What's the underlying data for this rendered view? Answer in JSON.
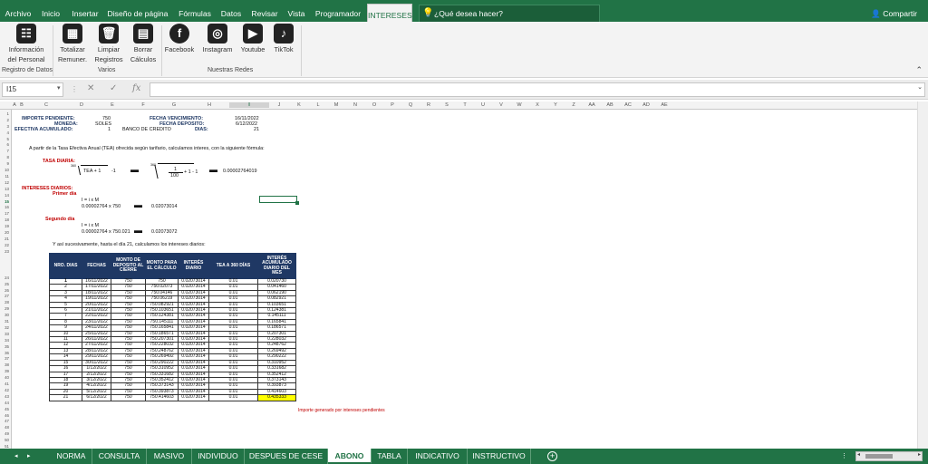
{
  "menu": {
    "tabs": [
      "Archivo",
      "Inicio",
      "Insertar",
      "Diseño de página",
      "Fórmulas",
      "Datos",
      "Revisar",
      "Vista",
      "Programador",
      "INTERESES"
    ],
    "search": "¿Qué desea hacer?",
    "share": "Compartir"
  },
  "ribbon": {
    "buttons": [
      "Información del Personal",
      "Totalizar Remuner.",
      "Limpiar Registros",
      "Borrar Cálculos",
      "Facebook",
      "Instagram",
      "Youtube",
      "TikTok"
    ],
    "groups": [
      "Registro de Datos",
      "Varios",
      "Nuestras Redes"
    ]
  },
  "formula_bar": {
    "cell_ref": "I15",
    "fx": "fx",
    "value": ""
  },
  "columns": [
    "A",
    "B",
    "C",
    "D",
    "E",
    "F",
    "G",
    "H",
    "I",
    "J",
    "K",
    "L",
    "M",
    "N",
    "O",
    "P",
    "Q",
    "R",
    "S",
    "T",
    "U",
    "V",
    "W",
    "X",
    "Y",
    "Z",
    "AA",
    "AB",
    "AC",
    "AD",
    "AE"
  ],
  "rows_count": 51,
  "sheet": {
    "importe_label": "IMPORTE PENDIENTE:",
    "importe_value": "750",
    "moneda_label": "MONEDA:",
    "moneda_value": "SOLES",
    "efectivo_label": "EFECTIVA ACUMULADO:",
    "efectivo_value": "1",
    "banco": "BANCO DE CREDITO",
    "fvenc_label": "FECHA VENCIMIENTO:",
    "fvenc_value": "16/11/2022",
    "fdep_label": "FECHA DEPOSITO:",
    "fdep_value": "6/12/2022",
    "dias_label": "DIAS:",
    "dias_value": "21",
    "intro": "A partir de la Tasa Efectiva Anual (TEA) ofrecida según tarifario, calculamos interes, con la siguiente fórmula:",
    "tasa_label": "TASA DIARIA:",
    "root_idx": "360",
    "tea_text": "TEA + 1",
    "minus1": "-1",
    "frac_num": "1",
    "frac_den": "100",
    "plus1minus1": "+ 1 - 1",
    "tasa_result": "0.00002764019",
    "intereses_label": "INTERESES DIARIOS:",
    "primer": "Primer día",
    "f1": "I = i x M",
    "c1": "0.00002764 x 750",
    "r1": "0.02073014",
    "segundo": "Segundo día",
    "f2": "I = i x M",
    "c2": "0.00002764 x 750.021",
    "r2": "0.02073072",
    "suces": "Y así sucesivamente, hasta el día 21, calculamos los intereses diarios:",
    "note": "Importe generado por intereses pendientes"
  },
  "table": {
    "headers": [
      "NRO. DIAS",
      "FECHAS",
      "MONTO DE DEPOSITO AL CIERRE",
      "MONTO PARA EL CÁLCULO",
      "INTERÉS DIARIO",
      "TEA A 360 DÍAS",
      "INTERÉS ACUMULADO DIARIO DEL MES"
    ],
    "rows": [
      [
        "1",
        "16/11/2022",
        "750",
        "750",
        "0.02073014",
        "0.01",
        "0.020730"
      ],
      [
        "2",
        "17/11/2022",
        "750",
        "750.02073",
        "0.02073014",
        "0.01",
        "0.041460"
      ],
      [
        "3",
        "18/11/2022",
        "750",
        "750.04146",
        "0.02073014",
        "0.01",
        "0.062190"
      ],
      [
        "4",
        "19/11/2022",
        "750",
        "750.06219",
        "0.02073014",
        "0.01",
        "0.082921"
      ],
      [
        "5",
        "20/11/2022",
        "750",
        "750.082921",
        "0.02073014",
        "0.01",
        "0.103651"
      ],
      [
        "6",
        "21/11/2022",
        "750",
        "750.103651",
        "0.02073014",
        "0.01",
        "0.124381"
      ],
      [
        "7",
        "22/11/2022",
        "750",
        "750.124381",
        "0.02073014",
        "0.01",
        "0.145111"
      ],
      [
        "8",
        "23/11/2022",
        "750",
        "750.145111",
        "0.02073014",
        "0.01",
        "0.165841"
      ],
      [
        "9",
        "24/11/2022",
        "750",
        "750.165841",
        "0.02073014",
        "0.01",
        "0.186571"
      ],
      [
        "10",
        "25/11/2022",
        "750",
        "750.186571",
        "0.02073014",
        "0.01",
        "0.207301"
      ],
      [
        "11",
        "26/11/2022",
        "750",
        "750.207301",
        "0.02073014",
        "0.01",
        "0.228032"
      ],
      [
        "12",
        "27/11/2022",
        "750",
        "750.228032",
        "0.02073014",
        "0.01",
        "0.248762"
      ],
      [
        "13",
        "28/11/2022",
        "750",
        "750.248762",
        "0.02073014",
        "0.01",
        "0.269492"
      ],
      [
        "14",
        "29/11/2022",
        "750",
        "750.269492",
        "0.02073014",
        "0.01",
        "0.290222"
      ],
      [
        "15",
        "30/11/2022",
        "750",
        "750.290222",
        "0.02073014",
        "0.01",
        "0.310952"
      ],
      [
        "16",
        "1/12/2022",
        "750",
        "750.310952",
        "0.02073014",
        "0.01",
        "0.331682"
      ],
      [
        "17",
        "2/12/2022",
        "750",
        "750.331682",
        "0.02073014",
        "0.01",
        "0.352412"
      ],
      [
        "18",
        "3/12/2022",
        "750",
        "750.352412",
        "0.02073014",
        "0.01",
        "0.373143"
      ],
      [
        "19",
        "4/12/2022",
        "750",
        "750.373143",
        "0.02073014",
        "0.01",
        "0.393873"
      ],
      [
        "20",
        "5/12/2022",
        "750",
        "750.393873",
        "0.02073014",
        "0.01",
        "0.414603"
      ],
      [
        "21",
        "6/12/2022",
        "750",
        "750.414603",
        "0.02073014",
        "0.01",
        "0.435333"
      ]
    ]
  },
  "sheet_tabs": [
    "NORMA",
    "CONSULTA",
    "MASIVO",
    "INDIVIDUO",
    "DESPUES DE CESE",
    "ABONO",
    "TABLA",
    "INDICATIVO",
    "INSTRUCTIVO"
  ],
  "active_sheet": "ABONO",
  "colors": {
    "excel_green": "#217346",
    "navy": "#1f3864",
    "red": "#c00000",
    "highlight": "#ffff00"
  }
}
